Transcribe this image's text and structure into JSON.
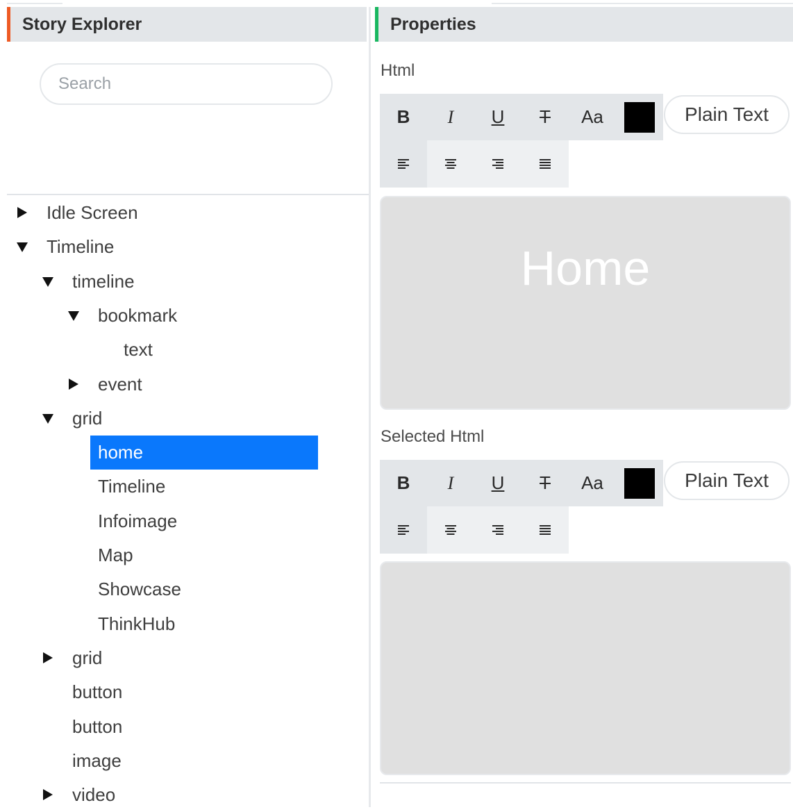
{
  "colors": {
    "story_explorer_accent": "#ee5a24",
    "properties_accent": "#19b760",
    "selection": "#0a78fc",
    "editor_bg": "#e0e0e0",
    "text_color_swatch": "#000000"
  },
  "story_explorer": {
    "title": "Story Explorer",
    "search": {
      "placeholder": "Search",
      "value": ""
    },
    "tree": [
      {
        "label": "Idle Screen",
        "arrow": "collapsed"
      },
      {
        "label": "Timeline",
        "arrow": "expanded"
      },
      {
        "label": "timeline",
        "arrow": "expanded"
      },
      {
        "label": "bookmark",
        "arrow": "expanded"
      },
      {
        "label": "text",
        "arrow": "none"
      },
      {
        "label": "event",
        "arrow": "collapsed"
      },
      {
        "label": "grid",
        "arrow": "expanded"
      },
      {
        "label": "home",
        "arrow": "none",
        "selected": true
      },
      {
        "label": "Timeline",
        "arrow": "none"
      },
      {
        "label": "Infoimage",
        "arrow": "none"
      },
      {
        "label": "Map",
        "arrow": "none"
      },
      {
        "label": "Showcase",
        "arrow": "none"
      },
      {
        "label": "ThinkHub",
        "arrow": "none"
      },
      {
        "label": "grid",
        "arrow": "collapsed"
      },
      {
        "label": "button",
        "arrow": "none"
      },
      {
        "label": "button",
        "arrow": "none"
      },
      {
        "label": "image",
        "arrow": "none"
      },
      {
        "label": "video",
        "arrow": "collapsed"
      }
    ]
  },
  "properties": {
    "title": "Properties",
    "html": {
      "label": "Html",
      "toolbar": {
        "bold": "B",
        "italic": "I",
        "underline": "U",
        "strike": "T",
        "font_size": "Aa",
        "plain_text": "Plain Text",
        "icons": [
          "bold-icon",
          "italic-icon",
          "underline-icon",
          "strikethrough-icon",
          "font-size-icon",
          "text-color-icon",
          "align-left-icon",
          "align-center-icon",
          "align-right-icon",
          "align-justify-icon"
        ]
      },
      "content": "Home"
    },
    "selected_html": {
      "label": "Selected Html",
      "toolbar": {
        "bold": "B",
        "italic": "I",
        "underline": "U",
        "strike": "T",
        "font_size": "Aa",
        "plain_text": "Plain Text"
      },
      "content": ""
    }
  }
}
